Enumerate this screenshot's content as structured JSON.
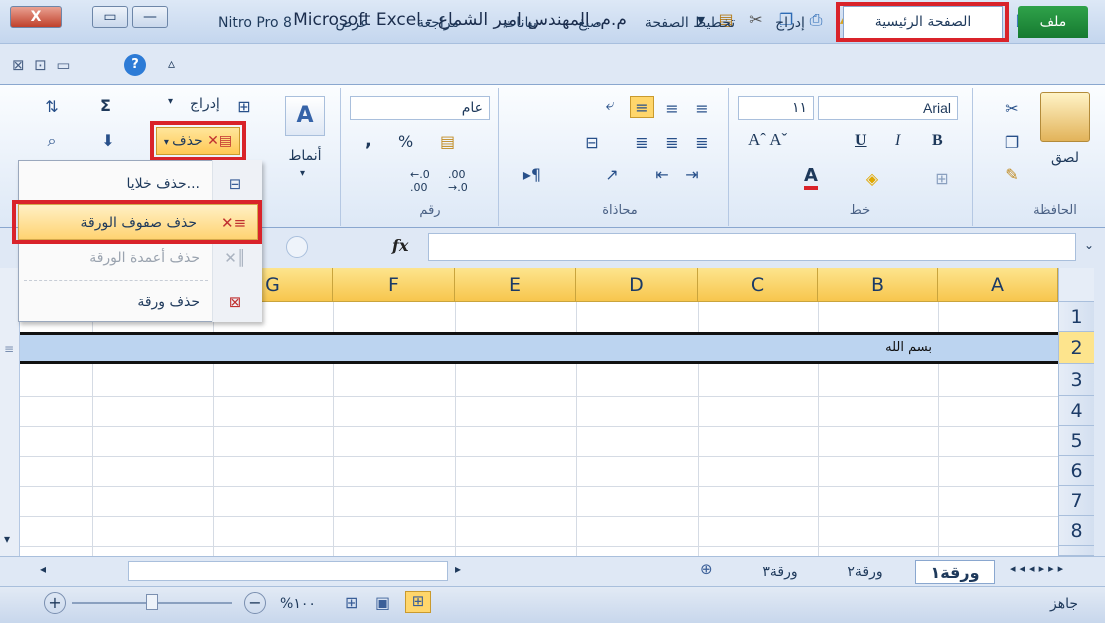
{
  "titlebar": {
    "title": "Microsoft Excel - م.م. المهندس امير الشماع",
    "close_glyph": "X",
    "restore_glyph": "▭",
    "minimize_glyph": "—",
    "excel_icon_glyph": "X"
  },
  "tabs": {
    "file": "ملف",
    "home": "الصفحة الرئيسية",
    "insert": "إدراج",
    "page_layout": "تخطيط الصفحة",
    "formulas": "صيغ",
    "data": "بيانات",
    "review": "مراجعة",
    "view": "عرض",
    "nitro": "Nitro Pro 8"
  },
  "ribbon": {
    "clipboard_label": "الحافظة",
    "paste_label": "لصق",
    "font_label": "خط",
    "font_name": "Arial",
    "font_size": "١١",
    "bold": "B",
    "italic": "I",
    "underline": "U",
    "alignment_label": "محاذاة",
    "number_label": "رقم",
    "number_format": "عام",
    "styles_label": "أنماط",
    "insert_label": "إدراج",
    "delete_label": "حذف",
    "sum_glyph": "Σ",
    "percent": "%",
    "comma": ",",
    "inc_decimal": ".00 ←.0",
    "dec_decimal": ".00 →.0"
  },
  "delete_menu": {
    "items": [
      {
        "label": "حذف خلايا...",
        "enabled": true
      },
      {
        "label": "حذف صفوف الورقة",
        "enabled": true
      },
      {
        "label": "حذف أعمدة الورقة",
        "enabled": false
      },
      {
        "label": "حذف ورقة",
        "enabled": true
      }
    ]
  },
  "formula_bar": {
    "fx": "fx",
    "value": ""
  },
  "grid": {
    "columns": [
      "A",
      "B",
      "C",
      "D",
      "E",
      "F",
      "G"
    ],
    "rows": [
      "1",
      "2",
      "3",
      "4",
      "5",
      "6",
      "7",
      "8"
    ],
    "cell_B2": "بسم الله",
    "selected_row": "2"
  },
  "sheets": [
    "ورقة١",
    "ورقة٢",
    "ورقة٣"
  ],
  "statusbar": {
    "ready": "جاهز",
    "zoom": "%١٠٠"
  },
  "colors": {
    "highlight_red": "#d9232a",
    "file_tab_green": "#1e8c3a",
    "header_gold": "#f7c64d",
    "selected_row_blue": "#bcd4f0"
  }
}
